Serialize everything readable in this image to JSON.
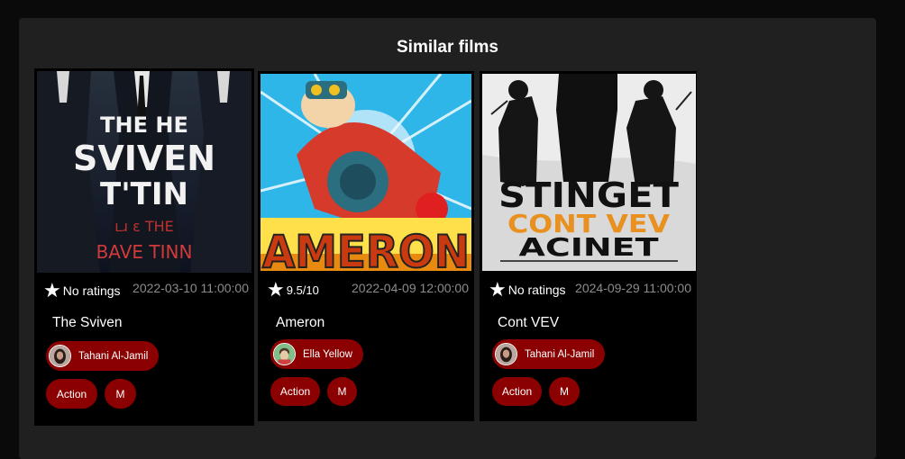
{
  "section": {
    "title": "Similar films"
  },
  "films": [
    {
      "poster_lines": [
        "THE HE",
        "SVIVEN",
        "T'TIN",
        "ʟɹ ɛ THE",
        "BAVE TINN"
      ],
      "rating": "No ratings",
      "date": "2022-03-10 11:00:00",
      "title": "The Sviven",
      "director": "Tahani Al-Jamil",
      "tags": [
        "Action",
        "M"
      ]
    },
    {
      "poster_lines": [
        "AMERON"
      ],
      "rating": "9.5/10",
      "date": "2022-04-09 12:00:00",
      "title": "Ameron",
      "director": "Ella Yellow",
      "tags": [
        "Action",
        "M"
      ]
    },
    {
      "poster_lines": [
        "STINGET",
        "CONT VEV",
        "ACINET"
      ],
      "rating": "No ratings",
      "date": "2024-09-29 11:00:00",
      "title": "Cont VEV",
      "director": "Tahani Al-Jamil",
      "tags": [
        "Action",
        "M"
      ]
    }
  ],
  "colors": {
    "chip": "#8b0000",
    "panel": "#202020",
    "card": "#000000"
  },
  "icons": {
    "rating": "star-icon"
  }
}
